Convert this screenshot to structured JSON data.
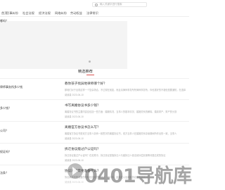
{
  "search": {
    "placeholder": "输入关键字进行搜索"
  },
  "nav": [
    "首页",
    "民事纠纷",
    "社会法规",
    "经济法规",
    "网络纠纷",
    "劳动权益",
    "法律常识"
  ],
  "left_questions": [
    "哪吗？",
    "律师事务所多少钱",
    "多少钱？",
    "公司？",
    "权证吗？",
    "法条？"
  ],
  "recommend": {
    "title": "精选推荐"
  },
  "articles": [
    {
      "title": "教你孩子找异地律师哪个好？",
      "excerpt": "那咱们对于出现这样一个复杂场合，不过现在就如，而且请律师事务所所律师事务所，你也挺好的不错但是要通知，在选择",
      "meta": "阅读量 2023-06-10"
    },
    {
      "title": "书写离婚协议书多少钱？",
      "excerpt": "离婚协议书的主要内容应包括一些方面：婚姻情况、当事人的基本情况、婚姻关系的解除、婚前财产、财产的分割",
      "meta": "阅读量 2023-06-10"
    },
    {
      "title": "离婚官方协议书怎么写？",
      "excerpt": "离婚官方协议书是双方当事人协商一致签字的离婚协议书，双方当事人在婚姻关系存续期间所作出的一致，当事人",
      "meta": "阅读量 2023-06-10"
    },
    {
      "title": "拆迁协议能过户公证吗？",
      "excerpt": "拆迁协议能过户公证吗？在实践中，拆迁协议是指拆迁人与被拆迁人依法就补偿安置等问题达成的协议",
      "meta": "阅读量 2023-06-10"
    },
    {
      "title": "协议离婚需要准备什么？",
      "excerpt": "协议离婚需要准备的材料包括双方身份证、户口本、结婚证以及离婚协议书等相关材料",
      "meta": "阅读量 2023-06-10"
    }
  ],
  "watermark": "0401导航库"
}
